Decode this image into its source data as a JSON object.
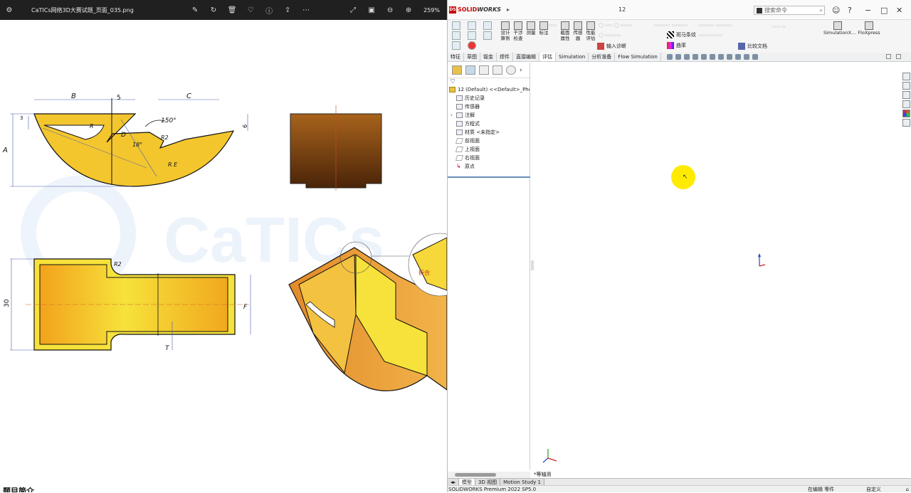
{
  "viewer": {
    "title": "CaTICs网络3D大赛试题_页面_035.png",
    "zoom": "259%",
    "bottom_text": "题目简介",
    "drawing_labels": {
      "B": "B",
      "five": "5",
      "C": "C",
      "angle150": "150°",
      "six": "6",
      "A": "A",
      "three": "3",
      "R_small": "R",
      "D": "D",
      "R2": "R2",
      "eighteen": "18°",
      "RE": "R E",
      "thirty": "30",
      "F": "F",
      "R2b": "R2",
      "T": "T",
      "bend": "折合"
    }
  },
  "sw": {
    "logo_ds": "DS",
    "logo_solid": "SOLID",
    "logo_works": "WORKS",
    "doc_title": "12",
    "search_placeholder": "搜索命令",
    "toolbar": {
      "design_check": "设计\n算例",
      "interference": "干涉\n检查",
      "measure": "测量",
      "markup": "标注",
      "section": "截面\n属性",
      "sensor": "传感\n器",
      "performance": "性能\n评估",
      "zebra": "斑马条纹",
      "curvature": "曲率",
      "import_diag": "输入诊断",
      "compare_doc": "比较文档",
      "simulationxpress": "SimulationX...",
      "floxpress": "FloXpress"
    },
    "tabs": [
      "特征",
      "草图",
      "钣金",
      "焊件",
      "直接编辑",
      "评估",
      "Simulation",
      "分析准备",
      "Flow Simulation"
    ],
    "active_tab": "评估",
    "tree": {
      "root": "12 (Default) <<Default>_Photo",
      "history": "历史记录",
      "sensors": "传感器",
      "annotations": "注解",
      "equations": "方程式",
      "material": "材质 <未指定>",
      "front": "前视面",
      "top": "上视面",
      "right": "右视面",
      "origin": "原点"
    },
    "view_label": "*等轴测",
    "bottom_tabs": [
      "模型",
      "3D 视图",
      "Motion Study 1"
    ],
    "status": {
      "product": "SOLIDWORKS Premium 2022 SP5.0",
      "mode": "在编辑 零件",
      "custom": "自定义"
    }
  }
}
